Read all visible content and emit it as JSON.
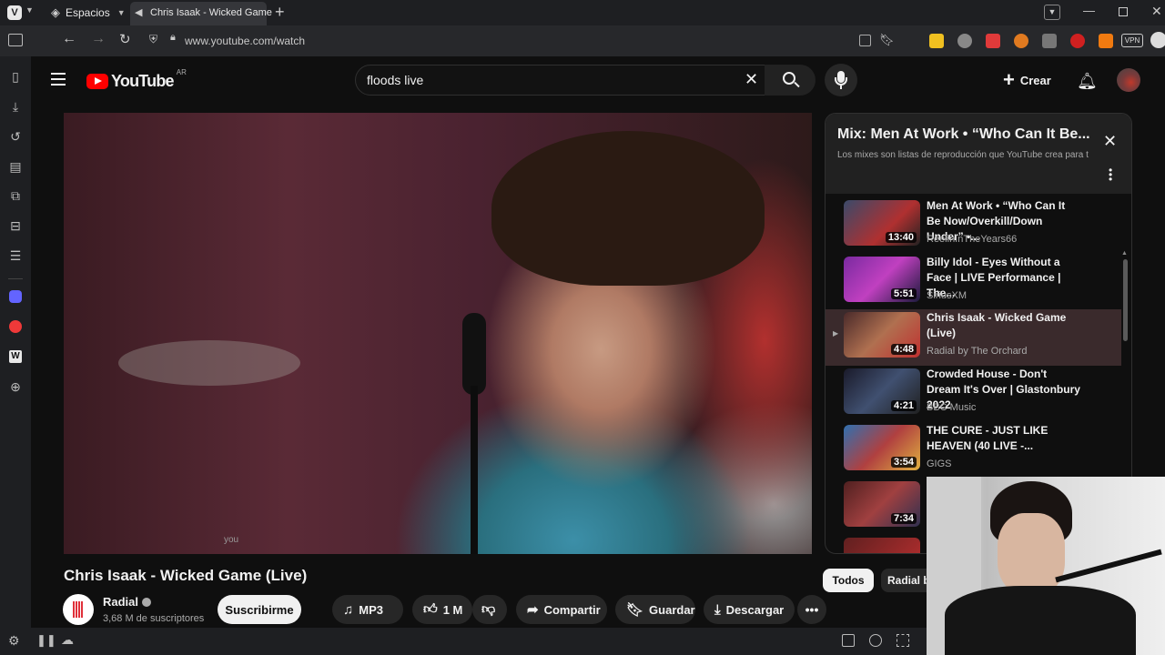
{
  "browser": {
    "workspace_label": "Espacios",
    "tab_title": "Chris Isaak - Wicked Game",
    "url": "www.youtube.com/watch",
    "vpn_label": "VPN"
  },
  "youtube": {
    "logo_text": "YouTube",
    "country_code": "AR",
    "search_value": "floods live",
    "create_label": "Crear",
    "video": {
      "title": "Chris Isaak - Wicked Game (Live)",
      "caption_hint": "you",
      "channel": "Radial",
      "subscribers": "3,68 M de suscriptores",
      "subscribe_label": "Suscribirme",
      "mp3_label": "MP3",
      "likes": "1 M",
      "share_label": "Compartir",
      "save_label": "Guardar",
      "download_label": "Descargar"
    },
    "playlist": {
      "title": "Mix: Men At Work • “Who Can It Be...",
      "subtitle": "Los mixes son listas de reproducción que YouTube crea para t",
      "items": [
        {
          "title": "Men At Work • “Who Can It Be Now/Overkill/Down Under” •...",
          "channel": "ReelinInTheYears66",
          "duration": "13:40",
          "active": false
        },
        {
          "title": "Billy Idol - Eyes Without a Face | LIVE Performance | The...",
          "channel": "SiriusXM",
          "duration": "5:51",
          "active": false
        },
        {
          "title": "Chris Isaak - Wicked Game (Live)",
          "channel": "Radial by The Orchard",
          "duration": "4:48",
          "active": true
        },
        {
          "title": "Crowded House - Don't Dream It's Over | Glastonbury 2022",
          "channel": "BBC Music",
          "duration": "4:21",
          "active": false
        },
        {
          "title": "THE CURE - JUST LIKE HEAVEN (40 LIVE -...",
          "channel": "GIGS",
          "duration": "3:54",
          "active": false
        },
        {
          "title": "",
          "channel": "",
          "duration": "7:34",
          "active": false
        }
      ]
    },
    "chips": {
      "all": "Todos",
      "radial": "Radial b"
    }
  },
  "colors": {
    "yt_red": "#ff0000",
    "background": "#0f0f0f",
    "active_item": "#3a2a2c"
  }
}
